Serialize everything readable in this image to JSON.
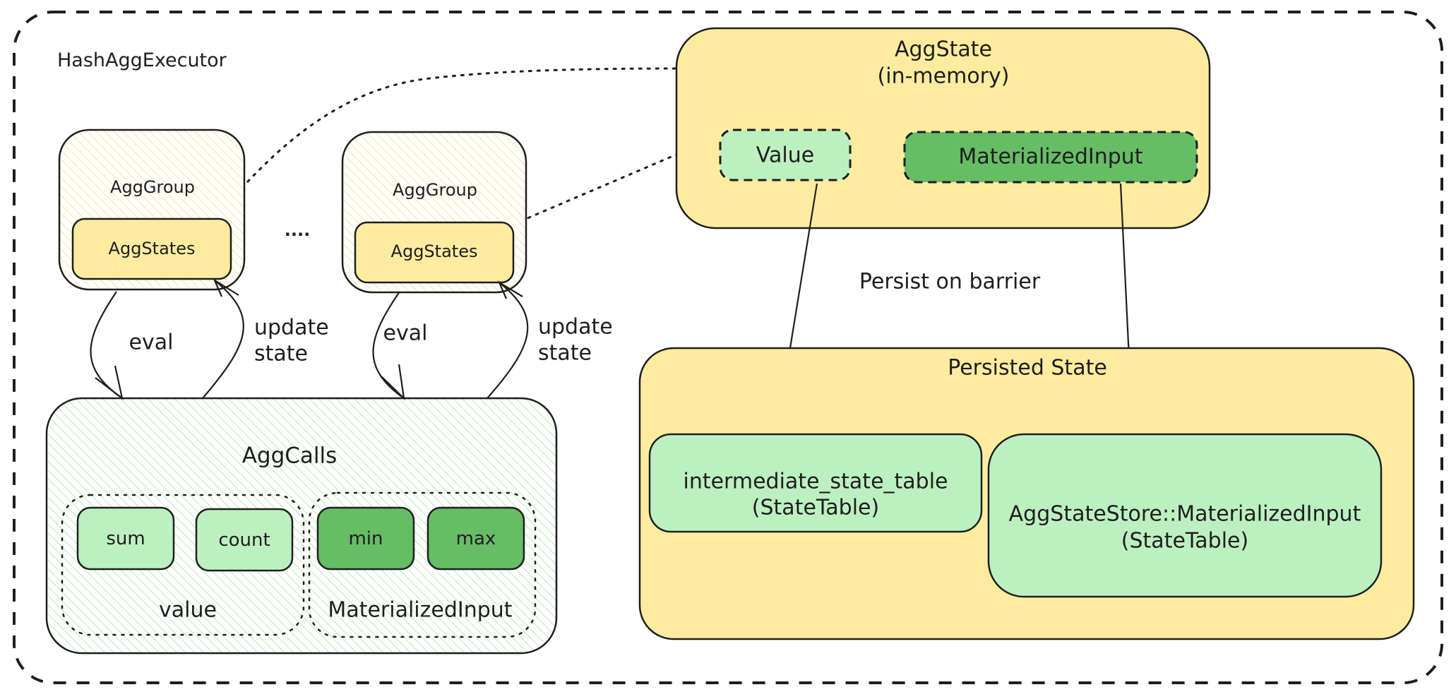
{
  "title": "HashAggExecutor",
  "colors": {
    "yellow": "#fdec9f",
    "light_green": "#bdf0c1",
    "dark_green": "#66bd66",
    "stroke": "#1e1e1e",
    "hatch_yellow": "#f6df84",
    "hatch_green": "#a8e4ad"
  },
  "agg_groups": [
    {
      "label": "AggGroup",
      "inner_label": "AggStates",
      "eval_label": "eval",
      "update_label_line1": "update",
      "update_label_line2": "state"
    },
    {
      "label": "AggGroup",
      "inner_label": "AggStates",
      "eval_label": "eval",
      "update_label_line1": "update",
      "update_label_line2": "state"
    }
  ],
  "ellipsis": "....",
  "agg_calls": {
    "title": "AggCalls",
    "groups": [
      {
        "label": "value",
        "calls": [
          "sum",
          "count"
        ]
      },
      {
        "label": "MaterializedInput",
        "calls": [
          "min",
          "max"
        ]
      }
    ]
  },
  "agg_state": {
    "title_line1": "AggState",
    "title_line2": "(in-memory)",
    "value_label": "Value",
    "materialized_label": "MaterializedInput"
  },
  "persist_label": "Persist on barrier",
  "persisted_state": {
    "title": "Persisted State",
    "intermediate_line1": "intermediate_state_table",
    "intermediate_line2": "(StateTable)",
    "store_line1": "AggStateStore::MaterializedInput",
    "store_line2": "(StateTable)"
  }
}
